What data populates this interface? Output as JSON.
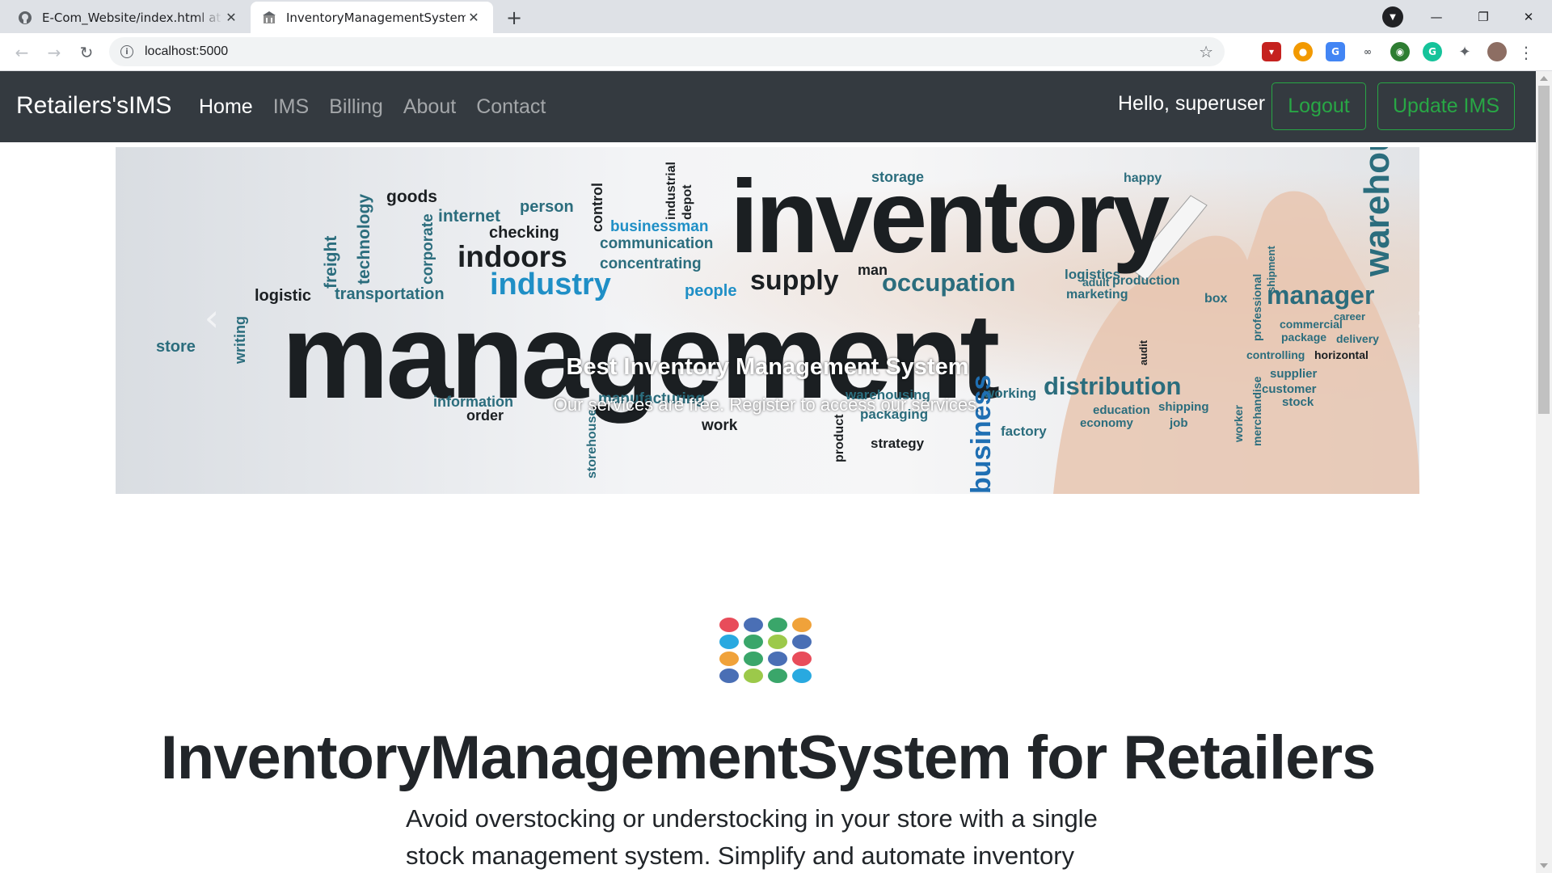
{
  "browser": {
    "tabs": [
      {
        "title": "E-Com_Website/index.html at master",
        "active": false
      },
      {
        "title": "InventoryManagementSystem",
        "active": true
      }
    ],
    "url": "localhost:5000"
  },
  "navbar": {
    "brand": "Retailers'sIMS",
    "links": [
      "Home",
      "IMS",
      "Billing",
      "About",
      "Contact"
    ],
    "active_link": "Home",
    "greeting": "Hello, superuser",
    "logout_label": "Logout",
    "update_label": "Update IMS",
    "accent": "#28a745"
  },
  "carousel": {
    "image_words": [
      "inventory",
      "management",
      "industry",
      "indoors",
      "supply",
      "occupation",
      "distribution",
      "manager",
      "goods",
      "internet",
      "person",
      "checking",
      "logistic",
      "transportation",
      "businessman",
      "communication",
      "concentrating",
      "people",
      "storage",
      "happy",
      "warehouse",
      "logistics",
      "marketing",
      "store",
      "writing",
      "information",
      "order",
      "manufacturing",
      "work",
      "storehouse",
      "warehousing",
      "packaging",
      "strategy",
      "working",
      "factory",
      "economy",
      "education",
      "shipping",
      "job",
      "customer",
      "stock",
      "supplier",
      "controlling",
      "horizontal",
      "delivery",
      "career",
      "commercial",
      "package",
      "professional",
      "shipment",
      "box",
      "freight",
      "technology",
      "corporate",
      "control",
      "industrial",
      "depot",
      "man",
      "adult",
      "production",
      "audit",
      "merchandise",
      "worker",
      "business",
      "product"
    ],
    "caption_title": "Best Inventory Management System",
    "caption_text": "Our services are free. Register to access our services."
  },
  "main": {
    "title": "InventoryManagementSystem for Retailers",
    "lead": "Avoid overstocking or understocking in your store with a single stock management system. Simplify and automate inventory planning with"
  }
}
